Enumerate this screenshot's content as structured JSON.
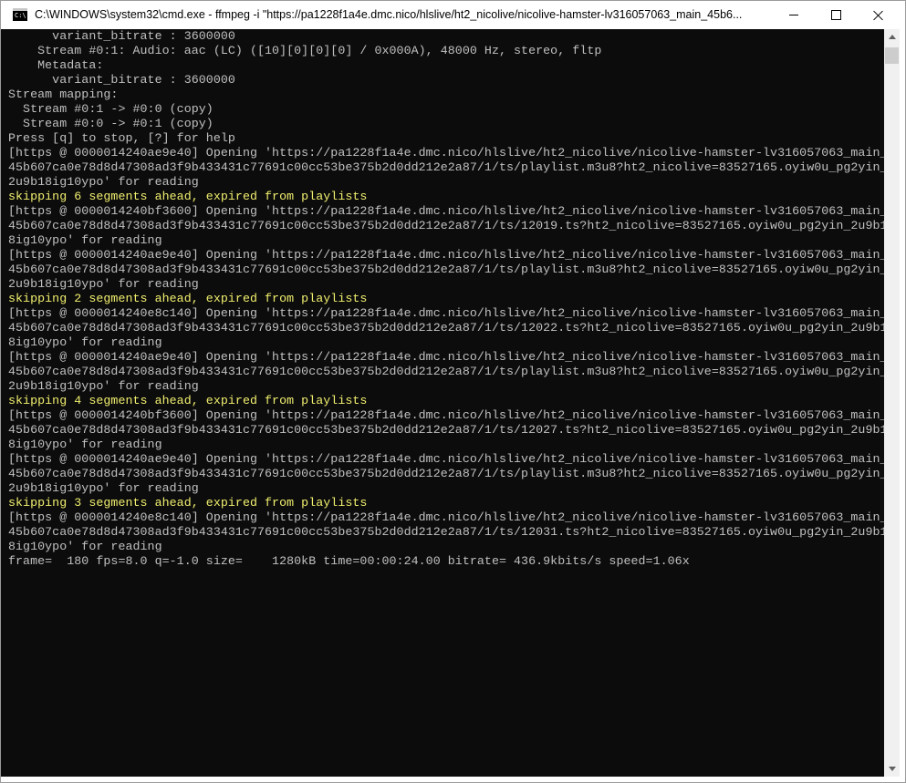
{
  "window": {
    "title": "C:\\WINDOWS\\system32\\cmd.exe - ffmpeg  -i \"https://pa1228f1a4e.dmc.nico/hlslive/ht2_nicolive/nicolive-hamster-lv316057063_main_45b6...",
    "app_icon_text": "C:\\"
  },
  "colors": {
    "console_bg": "#0c0c0c",
    "console_text": "#c0c0c0",
    "warning_text": "#f1ef6e"
  },
  "console": {
    "lines": [
      {
        "text": "      variant_bitrate : 3600000",
        "type": "normal"
      },
      {
        "text": "    Stream #0:1: Audio: aac (LC) ([10][0][0][0] / 0x000A), 48000 Hz, stereo, fltp",
        "type": "normal"
      },
      {
        "text": "    Metadata:",
        "type": "normal"
      },
      {
        "text": "      variant_bitrate : 3600000",
        "type": "normal"
      },
      {
        "text": "Stream mapping:",
        "type": "normal"
      },
      {
        "text": "  Stream #0:1 -> #0:0 (copy)",
        "type": "normal"
      },
      {
        "text": "  Stream #0:0 -> #0:1 (copy)",
        "type": "normal"
      },
      {
        "text": "Press [q] to stop, [?] for help",
        "type": "normal"
      },
      {
        "text": "[https @ 0000014240ae9e40] Opening 'https://pa1228f1a4e.dmc.nico/hlslive/ht2_nicolive/nicolive-hamster-lv316057063_main_",
        "type": "normal"
      },
      {
        "text": "45b607ca0e78d8d47308ad3f9b433431c77691c00cc53be375b2d0dd212e2a87/1/ts/playlist.m3u8?ht2_nicolive=83527165.oyiw0u_pg2yin_",
        "type": "normal"
      },
      {
        "text": "2u9b18ig10ypo' for reading",
        "type": "normal"
      },
      {
        "text": "skipping 6 segments ahead, expired from playlists",
        "type": "warn"
      },
      {
        "text": "[https @ 0000014240bf3600] Opening 'https://pa1228f1a4e.dmc.nico/hlslive/ht2_nicolive/nicolive-hamster-lv316057063_main_",
        "type": "normal"
      },
      {
        "text": "45b607ca0e78d8d47308ad3f9b433431c77691c00cc53be375b2d0dd212e2a87/1/ts/12019.ts?ht2_nicolive=83527165.oyiw0u_pg2yin_2u9b1",
        "type": "normal"
      },
      {
        "text": "8ig10ypo' for reading",
        "type": "normal"
      },
      {
        "text": "[https @ 0000014240ae9e40] Opening 'https://pa1228f1a4e.dmc.nico/hlslive/ht2_nicolive/nicolive-hamster-lv316057063_main_",
        "type": "normal"
      },
      {
        "text": "45b607ca0e78d8d47308ad3f9b433431c77691c00cc53be375b2d0dd212e2a87/1/ts/playlist.m3u8?ht2_nicolive=83527165.oyiw0u_pg2yin_",
        "type": "normal"
      },
      {
        "text": "2u9b18ig10ypo' for reading",
        "type": "normal"
      },
      {
        "text": "skipping 2 segments ahead, expired from playlists",
        "type": "warn"
      },
      {
        "text": "[https @ 0000014240e8c140] Opening 'https://pa1228f1a4e.dmc.nico/hlslive/ht2_nicolive/nicolive-hamster-lv316057063_main_",
        "type": "normal"
      },
      {
        "text": "45b607ca0e78d8d47308ad3f9b433431c77691c00cc53be375b2d0dd212e2a87/1/ts/12022.ts?ht2_nicolive=83527165.oyiw0u_pg2yin_2u9b1",
        "type": "normal"
      },
      {
        "text": "8ig10ypo' for reading",
        "type": "normal"
      },
      {
        "text": "[https @ 0000014240ae9e40] Opening 'https://pa1228f1a4e.dmc.nico/hlslive/ht2_nicolive/nicolive-hamster-lv316057063_main_",
        "type": "normal"
      },
      {
        "text": "45b607ca0e78d8d47308ad3f9b433431c77691c00cc53be375b2d0dd212e2a87/1/ts/playlist.m3u8?ht2_nicolive=83527165.oyiw0u_pg2yin_",
        "type": "normal"
      },
      {
        "text": "2u9b18ig10ypo' for reading",
        "type": "normal"
      },
      {
        "text": "skipping 4 segments ahead, expired from playlists",
        "type": "warn"
      },
      {
        "text": "[https @ 0000014240bf3600] Opening 'https://pa1228f1a4e.dmc.nico/hlslive/ht2_nicolive/nicolive-hamster-lv316057063_main_",
        "type": "normal"
      },
      {
        "text": "45b607ca0e78d8d47308ad3f9b433431c77691c00cc53be375b2d0dd212e2a87/1/ts/12027.ts?ht2_nicolive=83527165.oyiw0u_pg2yin_2u9b1",
        "type": "normal"
      },
      {
        "text": "8ig10ypo' for reading",
        "type": "normal"
      },
      {
        "text": "[https @ 0000014240ae9e40] Opening 'https://pa1228f1a4e.dmc.nico/hlslive/ht2_nicolive/nicolive-hamster-lv316057063_main_",
        "type": "normal"
      },
      {
        "text": "45b607ca0e78d8d47308ad3f9b433431c77691c00cc53be375b2d0dd212e2a87/1/ts/playlist.m3u8?ht2_nicolive=83527165.oyiw0u_pg2yin_",
        "type": "normal"
      },
      {
        "text": "2u9b18ig10ypo' for reading",
        "type": "normal"
      },
      {
        "text": "skipping 3 segments ahead, expired from playlists",
        "type": "warn"
      },
      {
        "text": "[https @ 0000014240e8c140] Opening 'https://pa1228f1a4e.dmc.nico/hlslive/ht2_nicolive/nicolive-hamster-lv316057063_main_",
        "type": "normal"
      },
      {
        "text": "45b607ca0e78d8d47308ad3f9b433431c77691c00cc53be375b2d0dd212e2a87/1/ts/12031.ts?ht2_nicolive=83527165.oyiw0u_pg2yin_2u9b1",
        "type": "normal"
      },
      {
        "text": "8ig10ypo' for reading",
        "type": "normal"
      },
      {
        "text": "frame=  180 fps=8.0 q=-1.0 size=    1280kB time=00:00:24.00 bitrate= 436.9kbits/s speed=1.06x",
        "type": "normal"
      }
    ]
  }
}
